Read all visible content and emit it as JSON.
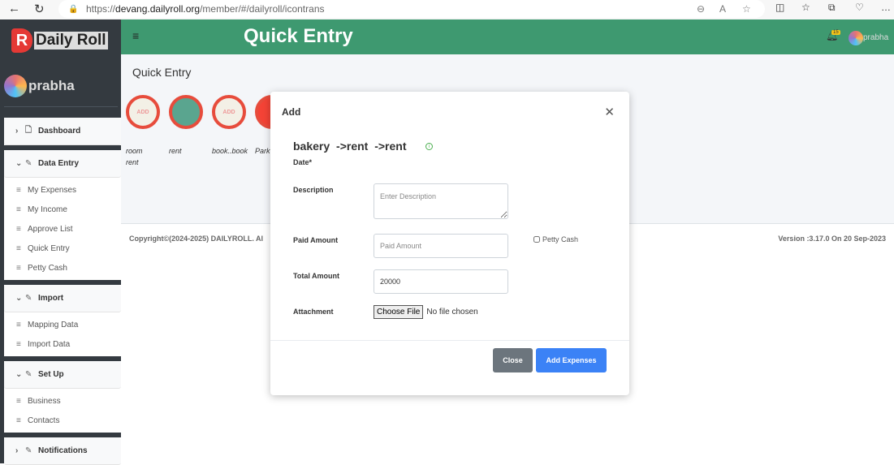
{
  "browser": {
    "url_prefix": "https://",
    "url_host": "devang.dailyroll.org",
    "url_path": "/member/#/dailyroll/icontrans"
  },
  "sidebar": {
    "logo_text": "Daily Roll",
    "logo_letter": "R",
    "user": "prabha",
    "dashboard": "Dashboard",
    "groups": [
      {
        "label": "Data Entry",
        "items": [
          "My Expenses",
          "My Income",
          "Approve List",
          "Quick Entry",
          "Petty Cash"
        ]
      },
      {
        "label": "Import",
        "items": [
          "Mapping Data",
          "Import Data"
        ]
      },
      {
        "label": "Set Up",
        "items": [
          "Business",
          "Contacts"
        ]
      }
    ],
    "notifications": "Notifications"
  },
  "header": {
    "title": "Quick Entry",
    "notification_count": "15",
    "user": "prabha",
    "accent": "#3e9970"
  },
  "content": {
    "title": "Quick Entry",
    "icons": [
      {
        "label": "room rent",
        "icon": "add-your-icon"
      },
      {
        "label": "rent",
        "icon": "books-icon"
      },
      {
        "label": "book..book",
        "icon": "add-your-icon"
      },
      {
        "label": "Park",
        "icon": "red-icon"
      }
    ]
  },
  "footer": {
    "copyright": "Copyright©(2024-2025) DAILYROLL. Al",
    "version": "Version :3.17.0 On 20 Sep-2023"
  },
  "modal": {
    "title": "Add",
    "path": "bakery ->rent ->rent",
    "date_label": "Date*",
    "description_label": "Description",
    "description_placeholder": "Enter Description",
    "description_value": "",
    "paid_label": "Paid Amount",
    "paid_placeholder": "Paid Amount",
    "paid_value": "",
    "petty_cash_label": "Petty Cash",
    "petty_cash_checked": false,
    "total_label": "Total Amount",
    "total_value": "20000",
    "attachment_label": "Attachment",
    "choose_file": "Choose File",
    "no_file": "No file chosen",
    "close_button": "Close",
    "add_button": "Add Expenses"
  }
}
